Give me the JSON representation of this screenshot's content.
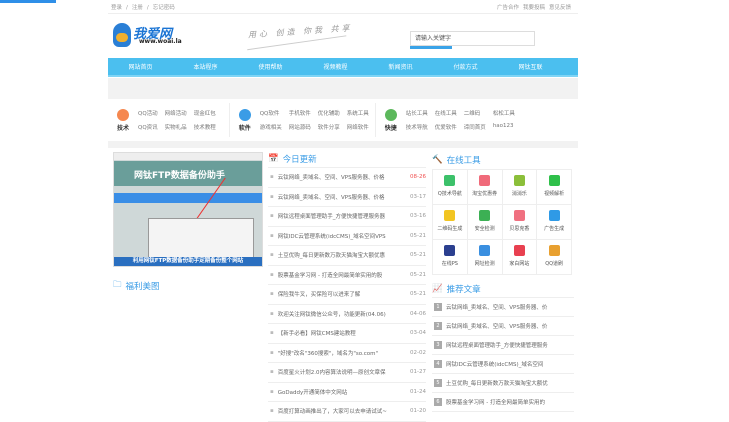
{
  "top": {
    "left": [
      "登录",
      "/",
      "注册",
      "/",
      "忘记密码"
    ],
    "right": [
      "广告合作",
      "我要投稿",
      "意见反馈"
    ]
  },
  "header": {
    "logo_text": "我爱网",
    "logo_url": "www.woai.la",
    "slogan": "用心 创造 你我 共享",
    "search_placeholder": "请输入关键字"
  },
  "nav": [
    "网站首页",
    "本站程序",
    "使用帮助",
    "视频教程",
    "新闻资讯",
    "付款方式",
    "网钛互联"
  ],
  "quick": [
    {
      "label": "技术",
      "color": "#f5874f",
      "links": [
        "QQ活动",
        "网络活动",
        "现金红包",
        "",
        "QQ资讯",
        "实物礼品",
        "技术教程",
        ""
      ]
    },
    {
      "label": "软件",
      "color": "#3a9ce6",
      "links": [
        "QQ软件",
        "手机软件",
        "优化辅助",
        "系统工具",
        "游戏相关",
        "网站源码",
        "软件分享",
        "网络软件"
      ]
    },
    {
      "label": "快捷",
      "color": "#5cb85c",
      "links": [
        "站长工具",
        "在线工具",
        "二维码",
        "松松工具",
        "技术导航",
        "优爱软件",
        "谛同首页",
        "hao123"
      ]
    }
  ],
  "feature": {
    "caption": "利用网钛FTP数据备份助手定期备份整个网站",
    "banner": "网钛FTP数据备份助手",
    "section": "福利美图"
  },
  "today": {
    "title": "今日更新",
    "items": [
      {
        "t": "云钛网络_卖域名、空间、VPS服务器、价格",
        "d": "08-26",
        "hot": true
      },
      {
        "t": "云钛网络_卖域名、空间、VPS服务器、价格",
        "d": "03-17"
      },
      {
        "t": "网钛远程桌面管理助手_方便快捷管理服务器",
        "d": "03-16"
      },
      {
        "t": "网钛IDC云管理系统(idcCMS)_域名空间VPS",
        "d": "05-21"
      },
      {
        "t": "土豆优购_每日更新数万款天猫淘宝大额优惠",
        "d": "05-21"
      },
      {
        "t": "股票基金学习网 - 打造全网最简单实用的股",
        "d": "05-21"
      },
      {
        "t": "保险我牛叉，买保险可以进来了解",
        "d": "05-21"
      },
      {
        "t": "欢迎关注网钛微信公众号，功能更新(04.06)",
        "d": "04-06"
      },
      {
        "t": "【新手必看】网钛CMS建站教程",
        "d": "03-04"
      },
      {
        "t": "\"好搜\"改名\"360搜索\"，域名为\"so.com\"",
        "d": "02-02"
      },
      {
        "t": "百度星火计划2.0内容算法说明—原创文章保",
        "d": "01-27"
      },
      {
        "t": "GoDaddy开通简体中文网站",
        "d": "01-24"
      },
      {
        "t": "百度打算动画推出了，大家可以去申请试试~",
        "d": "01-20"
      }
    ]
  },
  "tools": {
    "title": "在线工具",
    "items": [
      {
        "label": "Q技术导航",
        "color": "#3cc16a"
      },
      {
        "label": "淘宝优惠券",
        "color": "#f06a7a"
      },
      {
        "label": "消消乐",
        "color": "#8bbf3a"
      },
      {
        "label": "视频解析",
        "color": "#2fc04a"
      },
      {
        "label": "二维码生成",
        "color": "#f2c522"
      },
      {
        "label": "安全检测",
        "color": "#3cb054"
      },
      {
        "label": "贝思克香",
        "color": "#f07080"
      },
      {
        "label": "广告生成",
        "color": "#2f9ae6"
      },
      {
        "label": "在线PS",
        "color": "#2b3f8f"
      },
      {
        "label": "网址检测",
        "color": "#3a8fe0"
      },
      {
        "label": "家白网站",
        "color": "#e84050"
      },
      {
        "label": "QQ道刷",
        "color": "#e8a030"
      }
    ]
  },
  "recommend": {
    "title": "推荐文章",
    "items": [
      "云钛网络_卖域名、空间、VPS服务器、价",
      "云钛网络_卖域名、空间、VPS服务器、价",
      "网钛远程桌面管理助手_方便快捷管理服务",
      "网钛IDC云管理系统(idcCMS)_域名空间",
      "土豆优购_每日更新数万款天猫淘宝大额优",
      "股票基金学习网 - 打造全网最简单实用的"
    ]
  }
}
